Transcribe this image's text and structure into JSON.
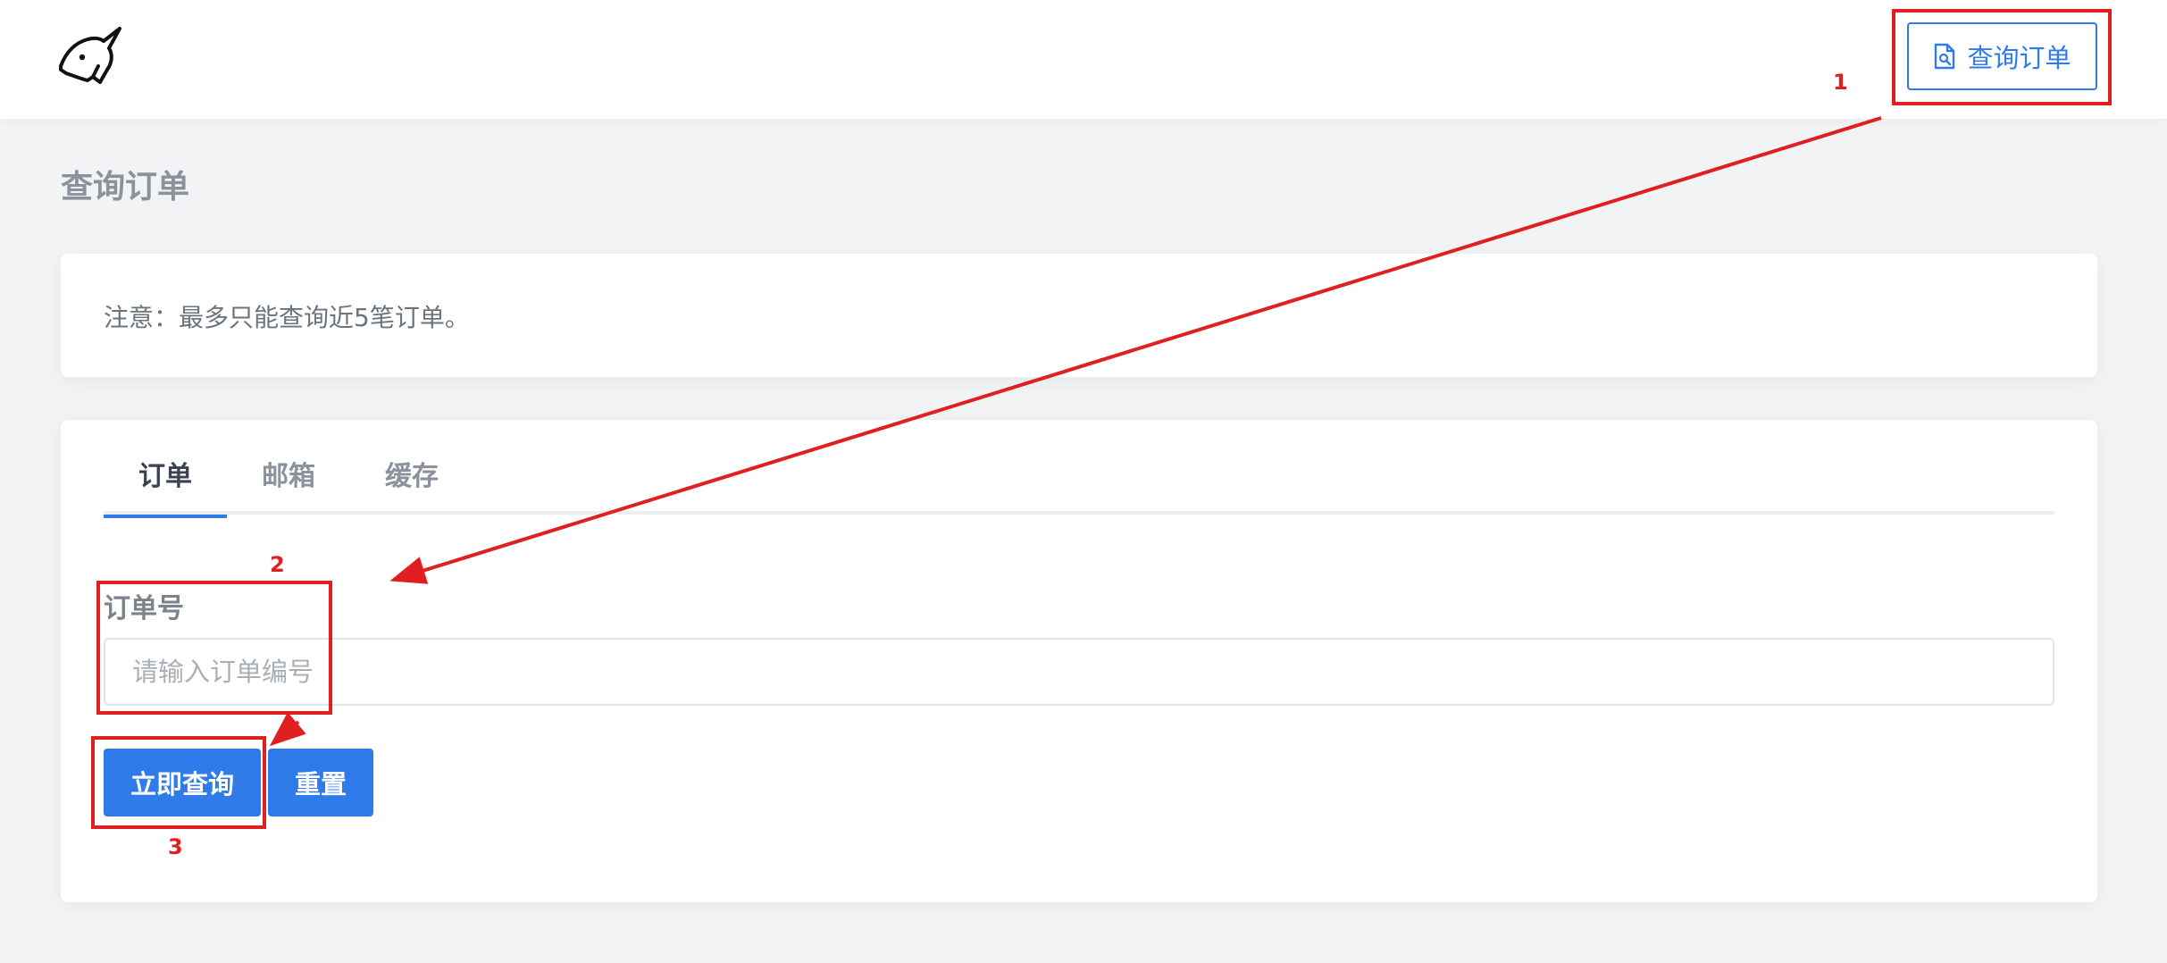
{
  "header": {
    "order_button_label": "查询订单"
  },
  "page": {
    "title": "查询订单"
  },
  "notice": {
    "text": "注意：最多只能查询近5笔订单。"
  },
  "tabs": [
    {
      "label": "订单",
      "active": true
    },
    {
      "label": "邮箱",
      "active": false
    },
    {
      "label": "缓存",
      "active": false
    }
  ],
  "form": {
    "field_label": "订单号",
    "input_placeholder": "请输入订单编号",
    "input_value": "",
    "search_button": "立即查询",
    "reset_button": "重置"
  },
  "annotations": {
    "step1": "1",
    "step2": "2",
    "step3": "3",
    "color": "#e02020"
  },
  "colors": {
    "accent": "#2f7bea",
    "background": "#f2f3f4"
  }
}
